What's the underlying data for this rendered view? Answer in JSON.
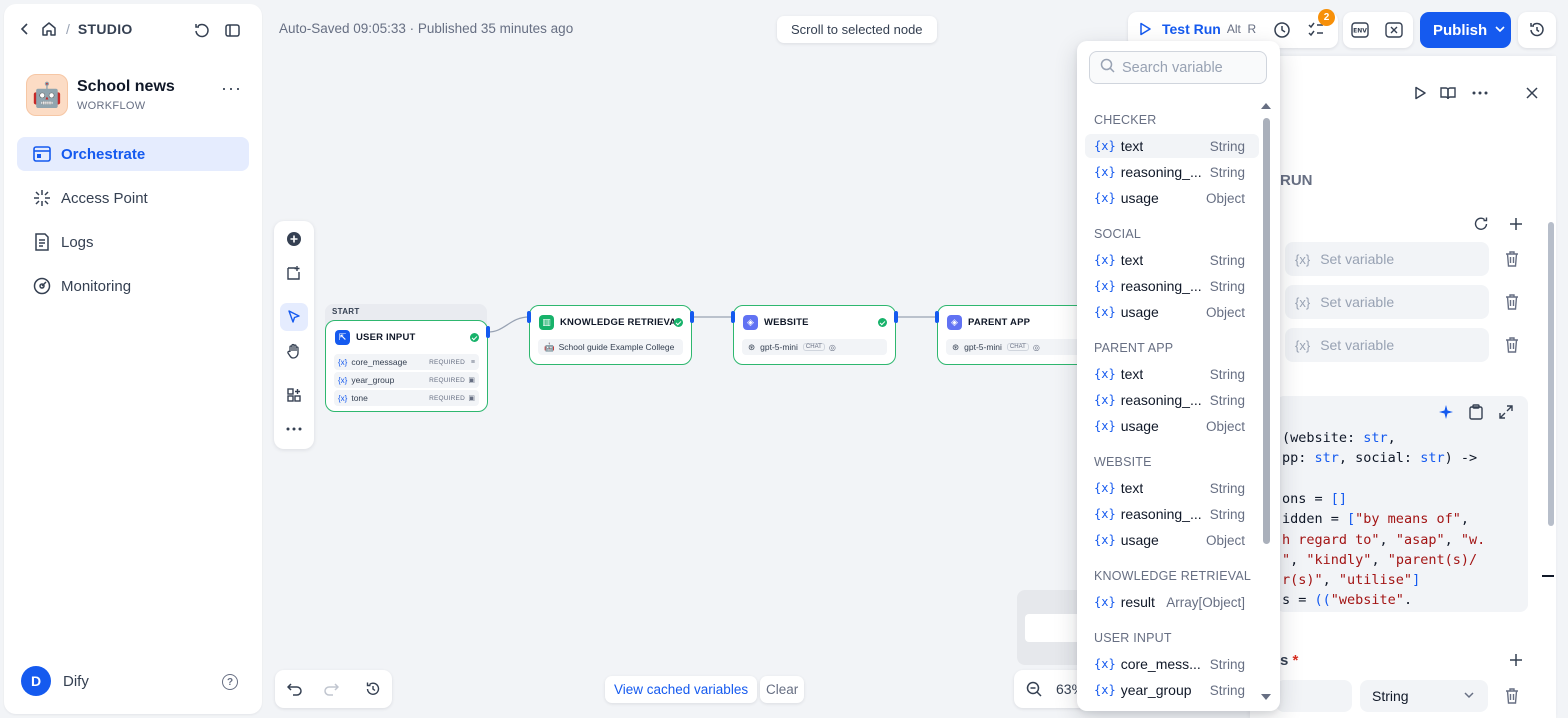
{
  "topnav": {
    "studio": "STUDIO"
  },
  "app": {
    "name": "School news",
    "type": "WORKFLOW",
    "avatar": "🤖"
  },
  "nav": [
    {
      "label": "Orchestrate",
      "icon": "orchestrate-icon",
      "active": true
    },
    {
      "label": "Access Point",
      "icon": "access-point-icon",
      "active": false
    },
    {
      "label": "Logs",
      "icon": "logs-icon",
      "active": false
    },
    {
      "label": "Monitoring",
      "icon": "monitoring-icon",
      "active": false
    }
  ],
  "user": {
    "initial": "D",
    "name": "Dify"
  },
  "header": {
    "autosave": "Auto-Saved 09:05:33 · Published 35 minutes ago",
    "scroll_to_node": "Scroll to selected node",
    "test_run": "Test Run",
    "test_run_shortcut": "Alt  R",
    "checklist_badge": "2",
    "publish": "Publish"
  },
  "nodes": {
    "start_label": "START",
    "user_input": {
      "title": "USER INPUT",
      "vars": [
        {
          "name": "core_message",
          "req": "REQUIRED"
        },
        {
          "name": "year_group",
          "req": "REQUIRED"
        },
        {
          "name": "tone",
          "req": "REQUIRED"
        }
      ]
    },
    "knowledge": {
      "title": "KNOWLEDGE RETRIEVAL",
      "sub": "School guide Example College"
    },
    "website": {
      "title": "WEBSITE",
      "model": "gpt-5-mini",
      "chip": "CHAT"
    },
    "parent_app": {
      "title": "PARENT APP",
      "model": "gpt-5-mini",
      "chip": "CHAT"
    }
  },
  "bottom": {
    "view_cached": "View cached variables",
    "clear": "Clear",
    "zoom": "63%"
  },
  "panel": {
    "run_label": "RUN",
    "set_variable": "Set variable",
    "output_label": "s",
    "output_type": "String",
    "code_lines": [
      [
        {
          "t": "(website: "
        },
        {
          "t": "str",
          "c": "kw"
        },
        {
          "t": ", "
        }
      ],
      [
        {
          "t": "pp: "
        },
        {
          "t": "str",
          "c": "kw"
        },
        {
          "t": ", social: "
        },
        {
          "t": "str",
          "c": "kw"
        },
        {
          "t": ") ->"
        }
      ],
      [
        {
          "t": ""
        }
      ],
      [
        {
          "t": "ons = "
        },
        {
          "t": "[]",
          "c": "kw"
        }
      ],
      [
        {
          "t": "idden = "
        },
        {
          "t": "[",
          "c": "kw"
        },
        {
          "t": "\"by means of\"",
          "c": "st"
        },
        {
          "t": ", "
        }
      ],
      [
        {
          "t": "h regard to\"",
          "c": "st"
        },
        {
          "t": ", "
        },
        {
          "t": "\"asap\"",
          "c": "st"
        },
        {
          "t": ", "
        },
        {
          "t": "\"w.",
          "c": "st"
        }
      ],
      [
        {
          "t": "\"",
          "c": "st"
        },
        {
          "t": ", "
        },
        {
          "t": "\"kindly\"",
          "c": "st"
        },
        {
          "t": ", "
        },
        {
          "t": "\"parent(s)/",
          "c": "st"
        }
      ],
      [
        {
          "t": "r(s)\"",
          "c": "st"
        },
        {
          "t": ", "
        },
        {
          "t": "\"utilise\"",
          "c": "st"
        },
        {
          "t": "]",
          "c": "kw"
        }
      ],
      [
        {
          "t": "s = "
        },
        {
          "t": "((",
          "c": "kw"
        },
        {
          "t": "\"website\"",
          "c": "st"
        },
        {
          "t": "."
        }
      ]
    ]
  },
  "variables": {
    "search_placeholder": "Search variable",
    "groups": [
      {
        "name": "CHECKER",
        "items": [
          {
            "name": "text",
            "type": "String",
            "selected": true
          },
          {
            "name": "reasoning_...",
            "type": "String"
          },
          {
            "name": "usage",
            "type": "Object"
          }
        ]
      },
      {
        "name": "SOCIAL",
        "items": [
          {
            "name": "text",
            "type": "String"
          },
          {
            "name": "reasoning_...",
            "type": "String"
          },
          {
            "name": "usage",
            "type": "Object"
          }
        ]
      },
      {
        "name": "PARENT APP",
        "items": [
          {
            "name": "text",
            "type": "String"
          },
          {
            "name": "reasoning_...",
            "type": "String"
          },
          {
            "name": "usage",
            "type": "Object"
          }
        ]
      },
      {
        "name": "WEBSITE",
        "items": [
          {
            "name": "text",
            "type": "String"
          },
          {
            "name": "reasoning_...",
            "type": "String"
          },
          {
            "name": "usage",
            "type": "Object"
          }
        ]
      },
      {
        "name": "KNOWLEDGE RETRIEVAL",
        "items": [
          {
            "name": "result",
            "type": "Array[Object]"
          }
        ]
      },
      {
        "name": "USER INPUT",
        "items": [
          {
            "name": "core_mess...",
            "type": "String"
          },
          {
            "name": "year_group",
            "type": "String"
          }
        ]
      }
    ]
  },
  "colors": {
    "accent": "#155aef",
    "success": "#17b26a",
    "badge": "#f79009",
    "danger": "#d92d20"
  }
}
